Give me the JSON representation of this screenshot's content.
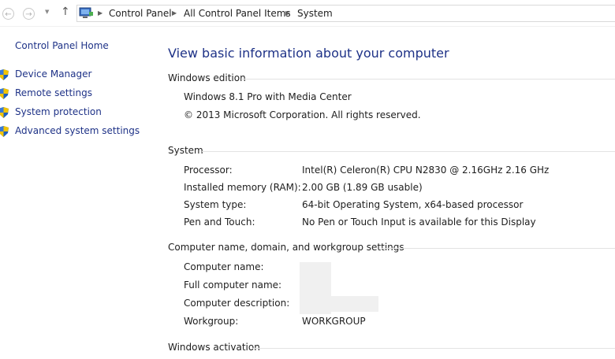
{
  "address_bar": {
    "breadcrumbs": [
      "Control Panel",
      "All Control Panel Items",
      "System"
    ]
  },
  "left_pane": {
    "home_link": "Control Panel Home",
    "links": [
      "Device Manager",
      "Remote settings",
      "System protection",
      "Advanced system settings"
    ]
  },
  "main": {
    "heading": "View basic information about your computer",
    "windows_edition": {
      "title": "Windows edition",
      "edition": "Windows 8.1 Pro with Media Center",
      "copyright": "© 2013 Microsoft Corporation. All rights reserved."
    },
    "system": {
      "title": "System",
      "rows": [
        {
          "label": "Processor:",
          "value": "Intel(R) Celeron(R) CPU  N2830  @ 2.16GHz   2.16 GHz"
        },
        {
          "label": "Installed memory (RAM):",
          "value": "2.00 GB (1.89 GB usable)"
        },
        {
          "label": "System type:",
          "value": "64-bit Operating System, x64-based processor"
        },
        {
          "label": "Pen and Touch:",
          "value": "No Pen or Touch Input is available for this Display"
        }
      ]
    },
    "computer_name": {
      "title": "Computer name, domain, and workgroup settings",
      "rows": [
        {
          "label": "Computer name:",
          "value": ""
        },
        {
          "label": "Full computer name:",
          "value": ""
        },
        {
          "label": "Computer description:",
          "value": ""
        },
        {
          "label": "Workgroup:",
          "value": "WORKGROUP"
        }
      ]
    },
    "activation": {
      "title": "Windows activation"
    }
  },
  "colors": {
    "link": "#1e3287",
    "section_line": "#e3e3e3"
  },
  "icons": {
    "back": "left-arrow-circle-icon",
    "forward": "right-arrow-circle-icon",
    "up": "up-arrow-icon",
    "control_panel": "control-panel-icon",
    "shield": "uac-shield-icon"
  }
}
